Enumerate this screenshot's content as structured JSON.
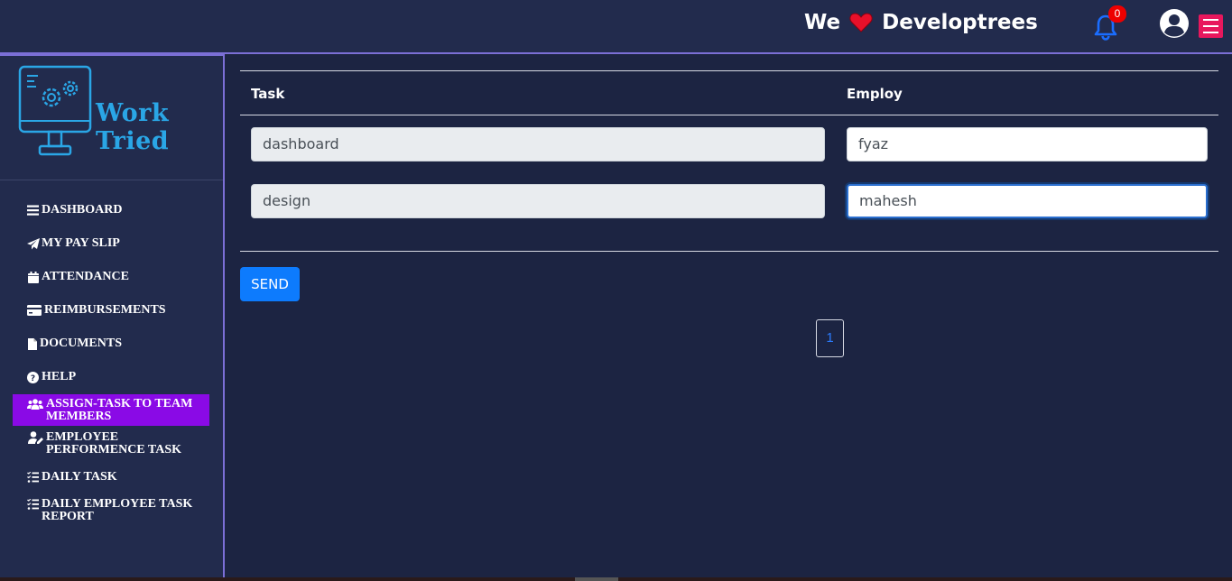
{
  "header": {
    "brand_pre": "We",
    "brand_post": "Developtrees",
    "notification_count": "0",
    "icons": [
      "heart-icon",
      "bell-icon",
      "user-circle-icon",
      "hamburger-menu-icon"
    ],
    "colors": {
      "heart": "#e8102a",
      "bell": "#1a6dff",
      "badge": "#e00000",
      "menu": "#e8175d"
    }
  },
  "sidebar": {
    "logo_text": "Work Tried",
    "items": [
      {
        "label": "DASHBOARD",
        "icon": "bars-icon",
        "active": false
      },
      {
        "label": "MY PAY SLIP",
        "icon": "paper-plane-icon",
        "active": false
      },
      {
        "label": "ATTENDANCE",
        "icon": "calendar-icon",
        "active": false
      },
      {
        "label": "REIMBURSEMENTS",
        "icon": "credit-card-icon",
        "active": false
      },
      {
        "label": "DOCUMENTS",
        "icon": "file-icon",
        "active": false
      },
      {
        "label": "HELP",
        "icon": "question-circle-icon",
        "active": false
      },
      {
        "label": "ASSIGN-TASK TO TEAM MEMBERS",
        "icon": "users-icon",
        "active": true
      },
      {
        "label": "EMPLOYEE PERFORMENCE TASK",
        "icon": "user-edit-icon",
        "active": false
      },
      {
        "label": "DAILY TASK",
        "icon": "tasks-icon",
        "active": false
      },
      {
        "label": "DAILY EMPLOYEE TASK REPORT",
        "icon": "tasks-icon",
        "active": false
      }
    ],
    "active_color": "#8a0ae6"
  },
  "main": {
    "columns": [
      "Task",
      "Employ"
    ],
    "rows": [
      {
        "task": "dashboard",
        "employ": "fyaz"
      },
      {
        "task": "design",
        "employ": "mahesh"
      }
    ],
    "send_label": "SEND",
    "pagination": [
      "1"
    ]
  }
}
